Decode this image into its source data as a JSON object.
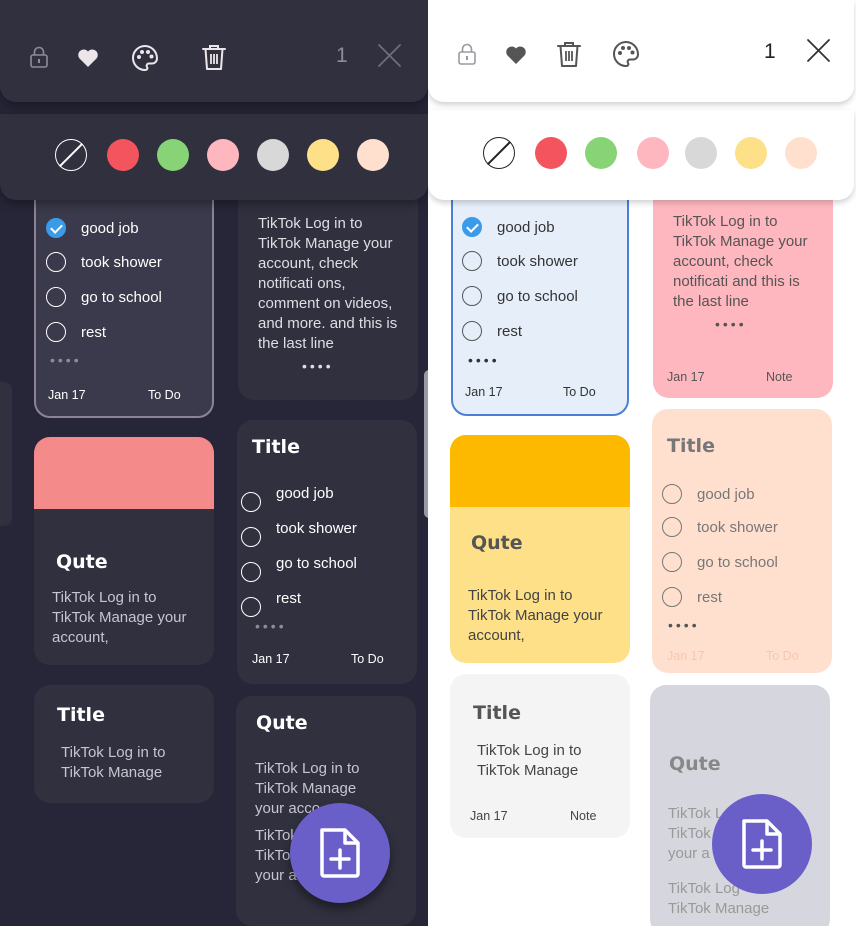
{
  "colors": {
    "dark_bg": "#262638",
    "dark_card": "#30303f",
    "light_card_blue": "#e6eefa",
    "accent_blue": "#3b9be8",
    "fab": "#6a5fc9"
  },
  "toolbar": {
    "counter": "1",
    "icons": [
      "lock-icon",
      "heart-icon",
      "palette-icon",
      "trash-icon",
      "close-icon"
    ]
  },
  "swatches": [
    "none",
    "#f4545e",
    "#88d376",
    "#ffb7bf",
    "#d8d8d8",
    "#fde088",
    "#ffe0cf"
  ],
  "notes": {
    "todo": {
      "items": [
        "good job",
        "took shower",
        "go to school",
        "rest"
      ],
      "checked": [
        true,
        false,
        false,
        false
      ],
      "date": "Jan 17",
      "kind": "To Do"
    },
    "tiktok_long": {
      "dark_text": "TikTok Log in to TikTok Manage your account, check notificati ons, comment on videos, and more. and this is the last line",
      "light_text": "TikTok Log in to TikTok Manage your account, check notificati and this is the last line",
      "date": "Jan 17",
      "kind": "Note"
    },
    "title_todo": {
      "title": "Title",
      "items": [
        "good job",
        "took shower",
        "go to school",
        "rest"
      ],
      "date": "Jan 17",
      "kind": "To Do"
    },
    "qute_short": {
      "title": "Qute",
      "text": "TikTok Log in to TikTok Manage your account,"
    },
    "title_note": {
      "title": "Title",
      "text": "TikTok Log in to TikTok Manage",
      "date": "Jan 17",
      "kind": "Note"
    },
    "qute_long": {
      "title": "Qute",
      "line1": "TikTok Log in to",
      "line2": "TikTok Manage",
      "line3": "your acco",
      "line4": "TikTok L",
      "line5": "TikTok",
      "line6": "your a",
      "light_line1": "TikTok L",
      "light_line2": "TikTok",
      "light_line3": "your a",
      "light_line4": "TikTok Log",
      "light_line5": "TikTok Manage"
    }
  }
}
